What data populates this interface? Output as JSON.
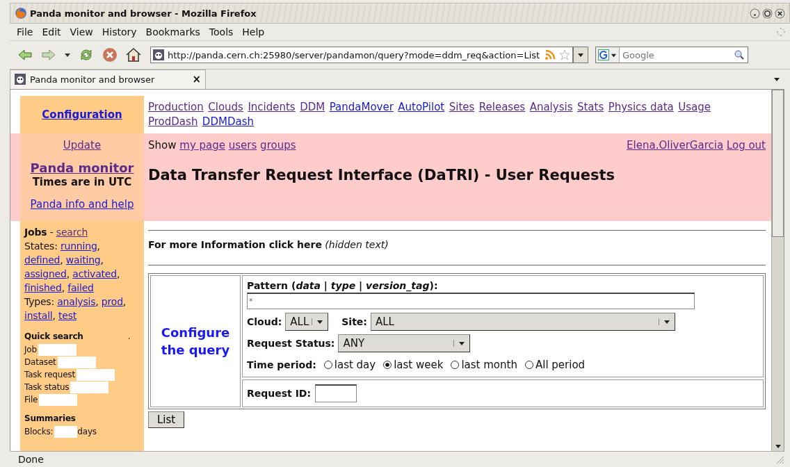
{
  "window": {
    "title": "Panda monitor and browser - Mozilla Firefox"
  },
  "menu": [
    "File",
    "Edit",
    "View",
    "History",
    "Bookmarks",
    "Tools",
    "Help"
  ],
  "address": {
    "value": "http://panda.cern.ch:25980/server/pandamon/query?mode=ddm_req&action=List"
  },
  "search": {
    "placeholder": "Google"
  },
  "tabs": [
    {
      "label": "Panda monitor and browser",
      "selected": true,
      "close": "×"
    }
  ],
  "sidebar": {
    "configuration": "Configuration",
    "update": "Update",
    "monitor": "Panda monitor",
    "times": "Times are in UTC",
    "help": "Panda info and help",
    "jobs_title": "Jobs",
    "jobs_sep": "-",
    "jobs_search": {
      "label": "search",
      "visited": true
    },
    "states_label": "States:",
    "states": [
      {
        "label": "running",
        "visited": false
      },
      {
        "label": "defined",
        "visited": false
      },
      {
        "label": "waiting",
        "visited": false
      },
      {
        "label": "assigned",
        "visited": false
      },
      {
        "label": "activated",
        "visited": false
      },
      {
        "label": "finished",
        "visited": false
      },
      {
        "label": "failed",
        "visited": false
      }
    ],
    "list_separator": ",",
    "types_label": "Types:",
    "types": [
      {
        "label": "analysis",
        "visited": false
      },
      {
        "label": "prod",
        "visited": false
      },
      {
        "label": "install",
        "visited": false
      },
      {
        "label": "test",
        "visited": false
      }
    ],
    "quick_search": "Quick search",
    "quick_dot": ".",
    "quick_fields": [
      {
        "label": "Job"
      },
      {
        "label": "Dataset"
      },
      {
        "label": "Task request"
      },
      {
        "label": "Task status"
      },
      {
        "label": "File"
      }
    ],
    "summaries": "Summaries",
    "blocks_label": "Blocks:",
    "blocks_unit": "days"
  },
  "nav_links": [
    {
      "label": "Production",
      "visited": true
    },
    {
      "label": "Clouds",
      "visited": true
    },
    {
      "label": "Incidents",
      "visited": true
    },
    {
      "label": "DDM",
      "visited": true
    },
    {
      "label": "PandaMover",
      "visited": false
    },
    {
      "label": "AutoPilot",
      "visited": false
    },
    {
      "label": "Sites",
      "visited": true
    },
    {
      "label": "Releases",
      "visited": true
    },
    {
      "label": "Analysis",
      "visited": true
    },
    {
      "label": "Stats",
      "visited": true
    },
    {
      "label": "Physics data",
      "visited": true
    },
    {
      "label": "Usage",
      "visited": true
    },
    {
      "label": "ProdDash",
      "visited": true
    },
    {
      "label": "DDMDash",
      "visited": false
    }
  ],
  "header": {
    "show_label": "Show",
    "show_links": [
      {
        "label": "my page",
        "visited": true
      },
      {
        "label": "users",
        "visited": true
      },
      {
        "label": "groups",
        "visited": true
      }
    ],
    "user": "Elena.OliverGarcia",
    "logout": "Log out",
    "title": "Data Transfer Request Interface (DaTRI) - User Requests"
  },
  "info": {
    "text": "For more Information click here",
    "note": "(hidden text)"
  },
  "form": {
    "side_title": "Configure the query",
    "pattern_label": "Pattern **(*data* | *type* | *version_tag*)**:",
    "pattern_value": "*",
    "cloud_label": "Cloud:",
    "cloud_value": "ALL",
    "site_label": "Site:",
    "site_value": "ALL",
    "status_label": "Request Status:",
    "status_value": "ANY",
    "period_label": "Time period:",
    "periods": [
      {
        "label": "last day",
        "selected": false
      },
      {
        "label": "last week",
        "selected": true
      },
      {
        "label": "last month",
        "selected": false
      },
      {
        "label": "All period",
        "selected": false
      }
    ],
    "request_id_label": "Request ID:",
    "list_button": "List"
  },
  "status_bar": {
    "text": "Done"
  }
}
